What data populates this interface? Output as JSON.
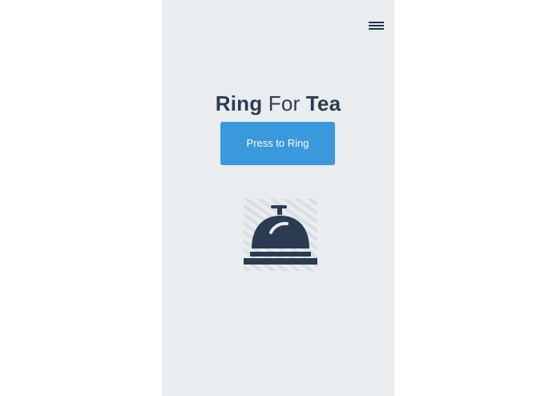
{
  "header": {
    "menu_icon": "hamburger-menu-icon"
  },
  "title": {
    "part1": "Ring",
    "part2": "For",
    "part3": "Tea"
  },
  "actions": {
    "ring_label": "Press to Ring"
  },
  "illustration": {
    "icon": "service-bell-icon"
  },
  "colors": {
    "background": "#e9edef",
    "accent": "#3a98dc",
    "text": "#2b3c52",
    "icon": "#24344a"
  }
}
